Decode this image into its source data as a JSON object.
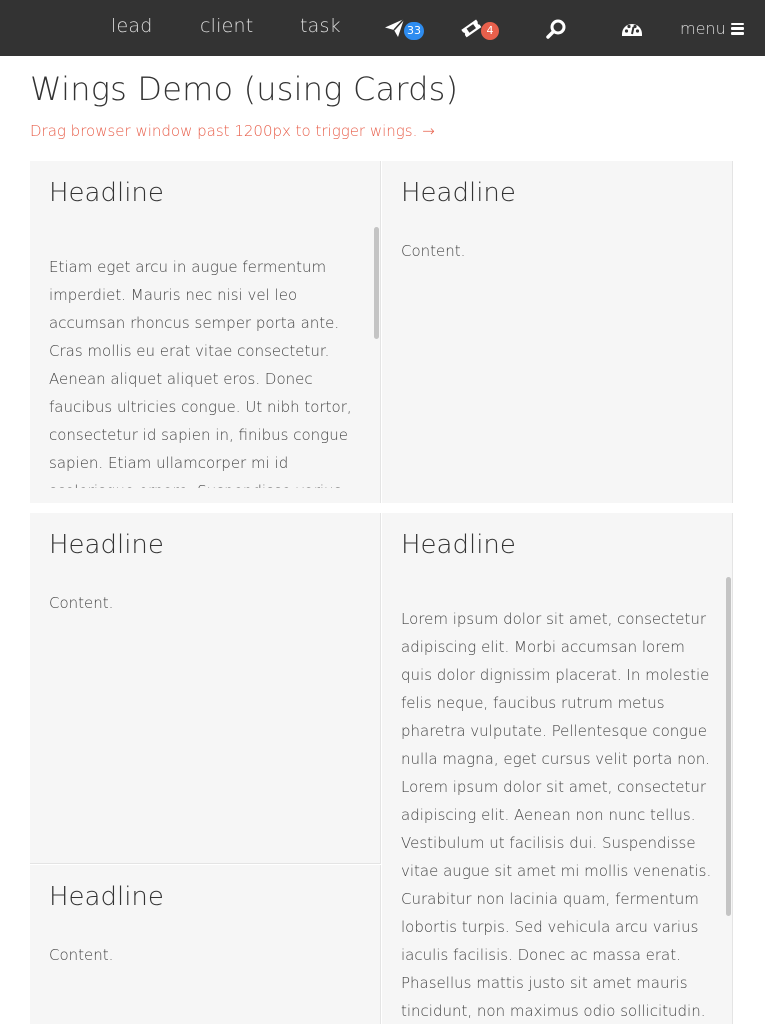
{
  "nav": {
    "links": [
      "lead",
      "client",
      "task"
    ],
    "send_badge": "33",
    "ticket_badge": "4",
    "menu_label": "menu",
    "colors": {
      "bar": "#333333",
      "badge_blue": "#2d8cf0",
      "badge_red": "#e8604c"
    }
  },
  "page": {
    "title": "Wings Demo (using Cards)",
    "subtitle": "Drag browser window past 1200px to trigger wings. →"
  },
  "cards": [
    {
      "headline": "Headline",
      "content": "Etiam eget arcu in augue fermentum imperdiet. Mauris nec nisi vel leo accumsan rhoncus semper porta ante. Cras mollis eu erat vitae consectetur. Aenean aliquet aliquet eros. Donec faucibus ultricies congue. Ut nibh tortor, consectetur id sapien in, finibus congue sapien. Etiam ullamcorper mi id scelerisque ornare. Suspendisse varius ullamcorper. Nam vel"
    },
    {
      "headline": "Headline",
      "content": "Content."
    },
    {
      "headline": "Headline",
      "content": "Content."
    },
    {
      "headline": "Headline",
      "content": "Lorem ipsum dolor sit amet, consectetur adipiscing elit. Morbi accumsan lorem quis dolor dignissim placerat. In molestie felis neque, faucibus rutrum metus pharetra vulputate. Pellentesque congue nulla magna, eget cursus velit porta non. Lorem ipsum dolor sit amet, consectetur adipiscing elit. Aenean non nunc tellus. Vestibulum ut facilisis dui. Suspendisse vitae augue sit amet mi mollis venenatis. Curabitur non lacinia quam, fermentum lobortis turpis. Sed vehicula arcu varius iaculis facilisis. Donec ac massa erat. Phasellus mattis justo sit amet mauris tincidunt, non maximus odio sollicitudin. Ut aliquam orci eget tincidunt"
    },
    {
      "headline": "Headline",
      "content": "Content."
    }
  ]
}
